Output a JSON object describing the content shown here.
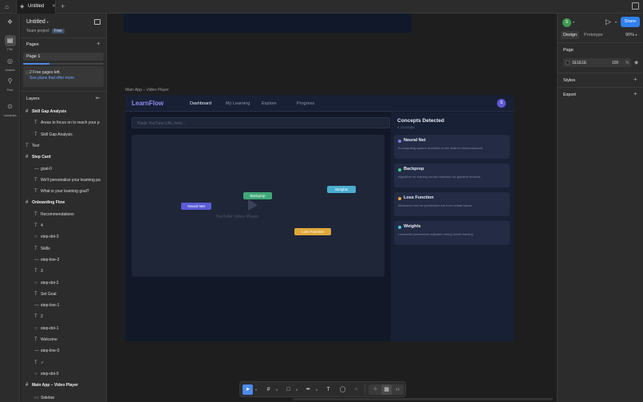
{
  "window": {
    "tab_title": "Untitled"
  },
  "rail": {
    "items": [
      {
        "label": "File",
        "icon": "file-icon"
      },
      {
        "label": "Assets",
        "icon": "assets-icon"
      },
      {
        "label": "Find",
        "icon": "search-icon"
      },
      {
        "label": "Variables",
        "icon": "variables-icon"
      }
    ]
  },
  "left_panel": {
    "project_name": "Untitled",
    "project_team": "Team project",
    "plan_badge": "Free",
    "pages_title": "Pages",
    "pages": [
      "Page 1"
    ],
    "free_pages_progress": 0.33,
    "notice_line1": "2 Free pages left.",
    "notice_line2": "See plans that offer more",
    "layers_title": "Layers",
    "layers": [
      {
        "name": "Skill Gap Analysis",
        "type": "frame",
        "indent": 0
      },
      {
        "name": "Areas to focus on to reach your p",
        "type": "text",
        "indent": 1
      },
      {
        "name": "Skill Gap Analysis",
        "type": "text",
        "indent": 1
      },
      {
        "name": "Text",
        "type": "text",
        "indent": 0
      },
      {
        "name": "Step Card",
        "type": "frame",
        "indent": 0
      },
      {
        "name": "goal-0",
        "type": "line",
        "indent": 1
      },
      {
        "name": "We'll personalise your learning pa",
        "type": "text",
        "indent": 1
      },
      {
        "name": "What is your learning goal?",
        "type": "text",
        "indent": 1
      },
      {
        "name": "Onboarding Flow",
        "type": "frame",
        "indent": 0
      },
      {
        "name": "Recommendations",
        "type": "text",
        "indent": 1
      },
      {
        "name": "4",
        "type": "text",
        "indent": 1
      },
      {
        "name": "step-dot-3",
        "type": "ellipse",
        "indent": 1
      },
      {
        "name": "Skills",
        "type": "text",
        "indent": 1
      },
      {
        "name": "step-line-2",
        "type": "line",
        "indent": 1
      },
      {
        "name": "3",
        "type": "text",
        "indent": 1
      },
      {
        "name": "step-dot-2",
        "type": "ellipse",
        "indent": 1
      },
      {
        "name": "Set Goal",
        "type": "text",
        "indent": 1
      },
      {
        "name": "step-line-1",
        "type": "line",
        "indent": 1
      },
      {
        "name": "2",
        "type": "text",
        "indent": 1
      },
      {
        "name": "step-dot-1",
        "type": "ellipse",
        "indent": 1
      },
      {
        "name": "Welcome",
        "type": "text",
        "indent": 1
      },
      {
        "name": "step-line-0",
        "type": "line",
        "indent": 1
      },
      {
        "name": "✓",
        "type": "text",
        "indent": 1
      },
      {
        "name": "step-dot-0",
        "type": "ellipse",
        "indent": 1
      },
      {
        "name": "Main App – Video Player",
        "type": "frame",
        "indent": 0
      },
      {
        "name": "Sidebar",
        "type": "rect",
        "indent": 1
      }
    ]
  },
  "canvas": {
    "frame_label": "Main App – Video Player",
    "app": {
      "logo": "LearnFlow",
      "nav": [
        "Dashboard",
        "My Learning",
        "Explore",
        "Progress"
      ],
      "active_nav": "Dashboard",
      "avatar_initial": "S",
      "url_placeholder": "Paste YouTube URL here...",
      "player_caption": "YouTube Video Player",
      "chips": [
        {
          "label": "Neural Net",
          "color": "#5b5bd6"
        },
        {
          "label": "Backprop",
          "color": "#3fa878"
        },
        {
          "label": "Weights",
          "color": "#4aaecf"
        },
        {
          "label": "Loss Function",
          "color": "#e0a83a"
        }
      ],
      "concepts_title": "Concepts Detected",
      "concepts_count": "4 concepts",
      "concepts": [
        {
          "title": "Neural Net",
          "desc": "A computing system modeled on the brain's neural structure",
          "color": "#7b7bf0"
        },
        {
          "title": "Backprop",
          "desc": "Algorithm for training neural networks via gradient descent",
          "color": "#3fcf8e"
        },
        {
          "title": "Loss Function",
          "desc": "Measures how far predictions are from actual values",
          "color": "#f0a040"
        },
        {
          "title": "Weights",
          "desc": "Learnable parameters adjusted during model training",
          "color": "#4ac0e0"
        }
      ]
    }
  },
  "toolbar": {
    "tools": [
      "move-icon",
      "frame-icon",
      "rectangle-icon",
      "pen-icon",
      "text-icon",
      "comment-icon",
      "actions-icon",
      "ai-icon",
      "dev-mode-icon",
      "code-icon"
    ]
  },
  "right_panel": {
    "avatar_initial": "S",
    "share_label": "Share",
    "tabs": [
      "Design",
      "Prototype"
    ],
    "active_tab": "Design",
    "zoom": "90%",
    "page_title": "Page",
    "bg_hex": "1E1E1E",
    "bg_opacity": "100",
    "bg_pct": "%",
    "styles_title": "Styles",
    "export_title": "Export"
  }
}
